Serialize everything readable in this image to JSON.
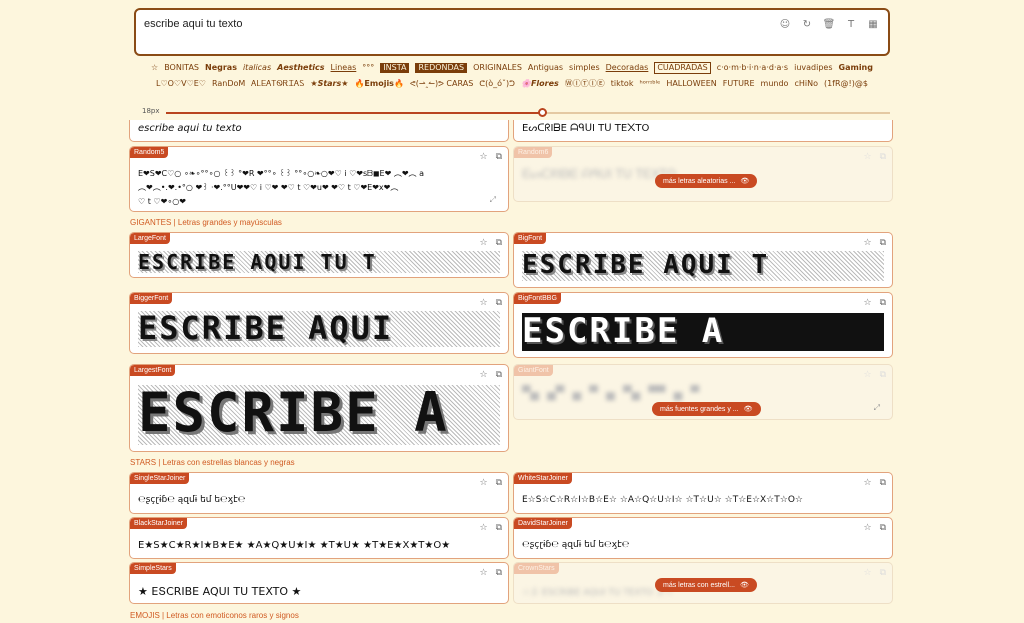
{
  "editor": {
    "text": "escribe aqui tu texto"
  },
  "categories": [
    {
      "label": "☆",
      "style": ""
    },
    {
      "label": "BONITAS",
      "style": ""
    },
    {
      "label": "Negras",
      "style": "b"
    },
    {
      "label": "italicas",
      "style": "i"
    },
    {
      "label": "Aesthetics",
      "style": "bi"
    },
    {
      "label": "Lineas",
      "style": "u"
    },
    {
      "label": "°°°",
      "style": ""
    },
    {
      "label": "INSTA",
      "style": "dark"
    },
    {
      "label": "REDONDAS",
      "style": "dark"
    },
    {
      "label": "ORIGINALES",
      "style": ""
    },
    {
      "label": "Antiguas",
      "style": ""
    },
    {
      "label": "simples",
      "style": ""
    },
    {
      "label": "Decoradas",
      "style": "u"
    },
    {
      "label": "CUADRADAS",
      "style": "box"
    },
    {
      "label": "c·o·m·b·i·n·a·d·a·s",
      "style": ""
    },
    {
      "label": "iuvadipes",
      "style": ""
    },
    {
      "label": "Gaming",
      "style": "b"
    },
    {
      "label": "L♡O♡V♡E♡",
      "style": ""
    },
    {
      "label": "RanDoM",
      "style": ""
    },
    {
      "label": "ᎪᏞᎬᎪᎢᏫᎡᏆᎪᏚ",
      "style": ""
    },
    {
      "label": "★Stars★",
      "style": "bi"
    },
    {
      "label": "🔥Emojis🔥",
      "style": "b"
    },
    {
      "label": "ᕙ(⇀‸↼)ᕗ CARAS",
      "style": ""
    },
    {
      "label": "ᕦ(ò_óˇ)ᕤ",
      "style": ""
    },
    {
      "label": "🌸Flores",
      "style": "bi"
    },
    {
      "label": "ⓌⒾⓉⒾⒺ",
      "style": ""
    },
    {
      "label": "tiktok",
      "style": ""
    },
    {
      "label": "ʰᵒʳʳᶦᵇˡᵉ",
      "style": ""
    },
    {
      "label": "HALLOWEEN",
      "style": ""
    },
    {
      "label": "FUTURE",
      "style": ""
    },
    {
      "label": "mundo",
      "style": ""
    },
    {
      "label": "cHiNo",
      "style": ""
    },
    {
      "label": "(1fR@!)@$",
      "style": ""
    }
  ],
  "slider": {
    "label": "18px",
    "value": 0.52
  },
  "sections": {
    "gigantes": "GIGANTES | Letras grandes y mayúsculas",
    "stars": "STARS | Letras con estrellas blancas y negras",
    "emojis": "EMOJIS | Letras con emoticonos raros y signos"
  },
  "cards": {
    "top_left_sample": "escribe aqui tu texto",
    "top_right_sample": "ΕᔕᑕᖇIᗷΕ ᗩᑫᑌI Tᑌ TΕ᙭TO",
    "random5": {
      "name": "Random5",
      "sample": "E❤S❤C♡○ ∘❧∘°°∘○ ꒰꒱ °❤R ❤°°∘ ꒰꒱ °°∘○❧○❤♡ i ♡❤sᗷ◼E❤ ︵❤︵ a\n︵❤︵•.❤.•°○ ❤꒱ ·❤.°°U❤❤♡ i ♡❤ ❤♡ t ♡❤u❤ ❤♡ t ♡❤E❤x❤︵\n♡ t ♡❤∘○❤"
    },
    "random_faded": {
      "name": "Random6",
      "sample": "ᗴᔕᑕᖇIᗷᗴ ᗩᑫᑌI Tᑌ TᗴXTO"
    },
    "more_random": "más letras aleatorias ...",
    "largefont": {
      "name": "LargeFont",
      "sample": "ESCRIBE AQUI TU T"
    },
    "bigfont": {
      "name": "BigFont",
      "sample": "ESCRIBE AQUI T"
    },
    "biggerfont": {
      "name": "BiggerFont",
      "sample": "ESCRIBE AQUI"
    },
    "bigfontbbg": {
      "name": "BigFontBBG",
      "sample": "ESCRIBE A"
    },
    "largestfont": {
      "name": "LargestFont",
      "sample": "ESCRIBE A"
    },
    "largest_faded": {
      "name": "GiantFont",
      "sample": "▀▄ ▄▀ ▄ ▀ ▄ ▀▄ ▀▀ ▄ ▀"
    },
    "more_big": "más fuentes grandes y ...",
    "singlestar": {
      "name": "SingleStarJoiner",
      "sample": "℮ʂçɽɨɓ℮ ąզմɨ եմ ե℮ӽէ℮"
    },
    "whitestar": {
      "name": "WhiteStarJoiner",
      "sample": "E☆S☆C☆R☆I☆B☆E☆ ☆A☆Q☆U☆I☆ ☆T☆U☆ ☆T☆E☆X☆T☆O☆"
    },
    "blackstar": {
      "name": "BlackStarJoiner",
      "sample": "E★S★C★R★I★B★E★ ★A★Q★U★I★ ★T★U★ ★T★E★X★T★O★"
    },
    "davidstar": {
      "name": "DavidStarJoiner",
      "sample": "℮ʂçɽɨɓ℮ ąզմɨ եմ ե℮ӽէ℮"
    },
    "simplestars": {
      "name": "SimpleStars",
      "sample": "★ EՏCRIBE AQUI TU TEXTO ★"
    },
    "crown_faded": {
      "name": "CrownStars",
      "sample": "☆彡 ESCRIBE AQUI TU TEXTO 彡☆"
    },
    "more_stars": "más letras con estrell..."
  }
}
